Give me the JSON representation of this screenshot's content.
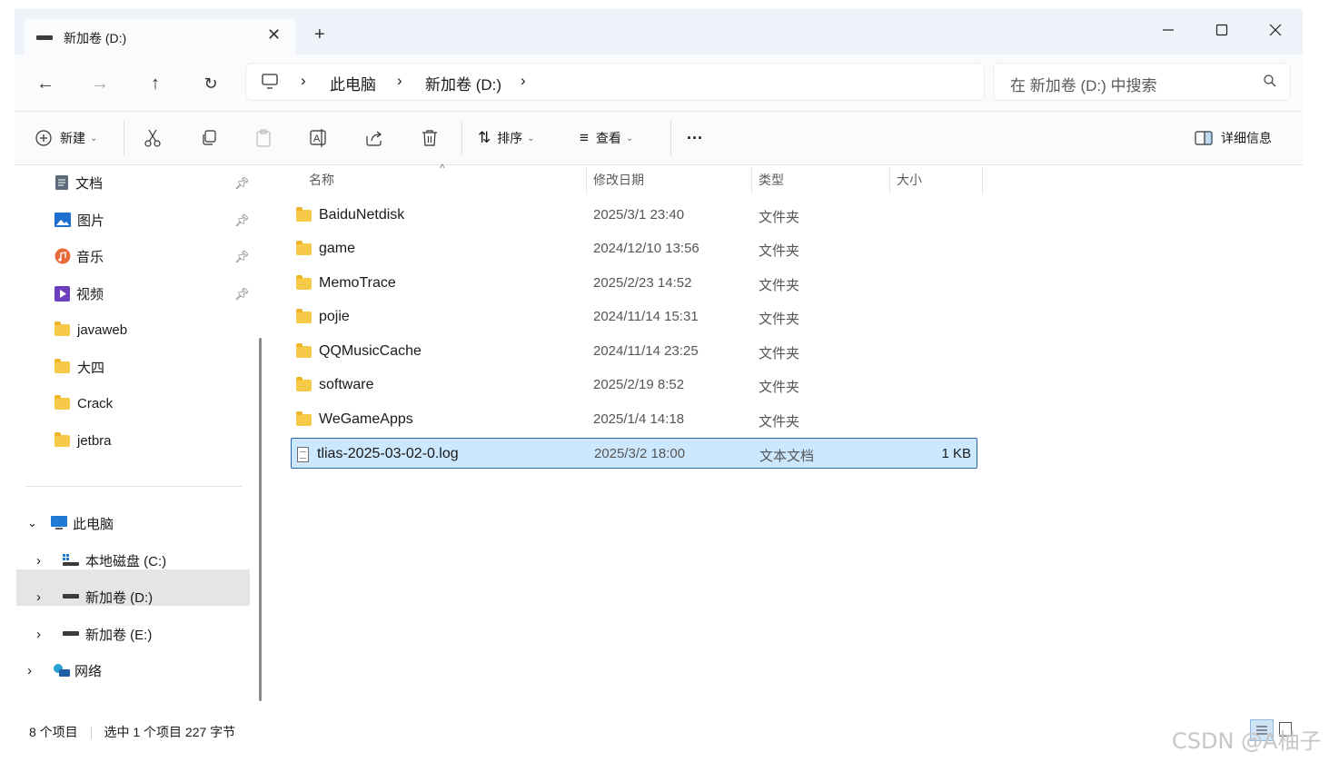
{
  "window": {
    "tab_title": "新加卷 (D:)"
  },
  "nav": {
    "breadcrumb": [
      "此电脑",
      "新加卷 (D:)"
    ],
    "search_placeholder": "在 新加卷 (D:) 中搜索"
  },
  "toolbar": {
    "new_label": "新建",
    "sort_label": "排序",
    "view_label": "查看",
    "more_label": "···",
    "details_label": "详细信息"
  },
  "sidebar": {
    "quick": [
      {
        "label": "文档",
        "icon": "documents-icon",
        "pinned": true
      },
      {
        "label": "图片",
        "icon": "pictures-icon",
        "pinned": true
      },
      {
        "label": "音乐",
        "icon": "music-icon",
        "pinned": true
      },
      {
        "label": "视频",
        "icon": "videos-icon",
        "pinned": true
      },
      {
        "label": "javaweb",
        "icon": "folder-icon",
        "pinned": false
      },
      {
        "label": "大四",
        "icon": "folder-icon",
        "pinned": false
      },
      {
        "label": "Crack",
        "icon": "folder-icon",
        "pinned": false
      },
      {
        "label": "jetbra",
        "icon": "folder-icon",
        "pinned": false
      }
    ],
    "this_pc": "此电脑",
    "drives": [
      "本地磁盘 (C:)",
      "新加卷 (D:)",
      "新加卷 (E:)"
    ],
    "network": "网络"
  },
  "columns": {
    "name": "名称",
    "date": "修改日期",
    "type": "类型",
    "size": "大小"
  },
  "files": [
    {
      "name": "BaiduNetdisk",
      "date": "2025/3/1 23:40",
      "type": "文件夹",
      "size": ""
    },
    {
      "name": "game",
      "date": "2024/12/10 13:56",
      "type": "文件夹",
      "size": ""
    },
    {
      "name": "MemoTrace",
      "date": "2025/2/23 14:52",
      "type": "文件夹",
      "size": ""
    },
    {
      "name": "pojie",
      "date": "2024/11/14 15:31",
      "type": "文件夹",
      "size": ""
    },
    {
      "name": "QQMusicCache",
      "date": "2024/11/14 23:25",
      "type": "文件夹",
      "size": ""
    },
    {
      "name": "software",
      "date": "2025/2/19 8:52",
      "type": "文件夹",
      "size": ""
    },
    {
      "name": "WeGameApps",
      "date": "2025/1/4 14:18",
      "type": "文件夹",
      "size": ""
    },
    {
      "name": "tlias-2025-03-02-0.log",
      "date": "2025/3/2 18:00",
      "type": "文本文档",
      "size": "1 KB"
    }
  ],
  "status": {
    "count": "8 个项目",
    "selection": "选中 1 个项目 227 字节"
  },
  "watermark": "CSDN @A柚子",
  "colors": {
    "selection_bg": "#cce8ff",
    "selection_border": "#2b64a8",
    "folder": "#f7c948",
    "titlebar": "#eef2f9"
  }
}
